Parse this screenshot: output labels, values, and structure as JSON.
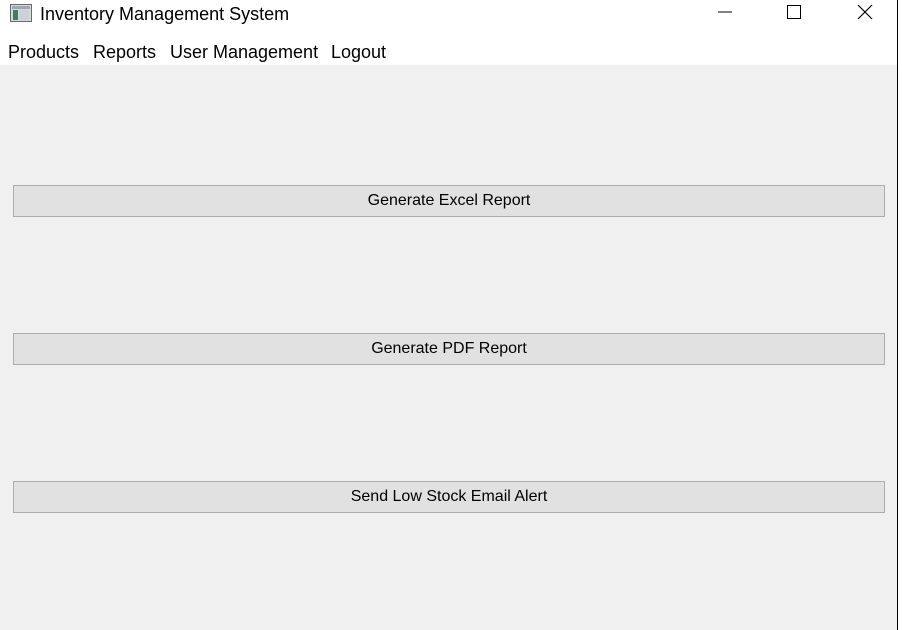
{
  "window": {
    "title": "Inventory Management System",
    "icon": "app-window-icon",
    "controls": {
      "minimize_icon": "minimize-icon",
      "maximize_icon": "maximize-icon",
      "close_icon": "close-icon"
    }
  },
  "menubar": {
    "items": [
      {
        "label": "Products"
      },
      {
        "label": "Reports"
      },
      {
        "label": "User Management"
      },
      {
        "label": "Logout"
      }
    ]
  },
  "actions": {
    "excel_label": "Generate Excel Report",
    "pdf_label": "Generate PDF Report",
    "email_label": "Send Low Stock Email Alert"
  },
  "colors": {
    "background": "#f0f0f0",
    "button_face": "#e1e1e1",
    "button_border": "#adadad",
    "titlebar": "#ffffff"
  }
}
